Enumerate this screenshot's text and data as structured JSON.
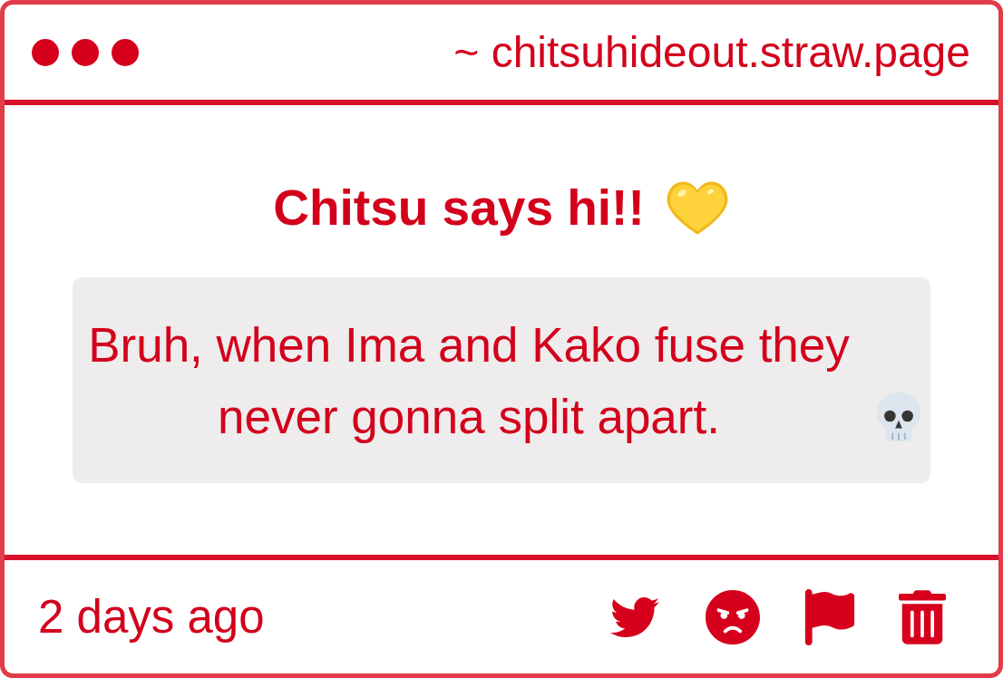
{
  "window": {
    "url": "~ chitsuhideout.straw.page"
  },
  "post": {
    "title": "Chitsu says hi!!",
    "message": "Bruh, when Ima and Kako fuse they never gonna split apart."
  },
  "footer": {
    "time": "2 days ago"
  }
}
